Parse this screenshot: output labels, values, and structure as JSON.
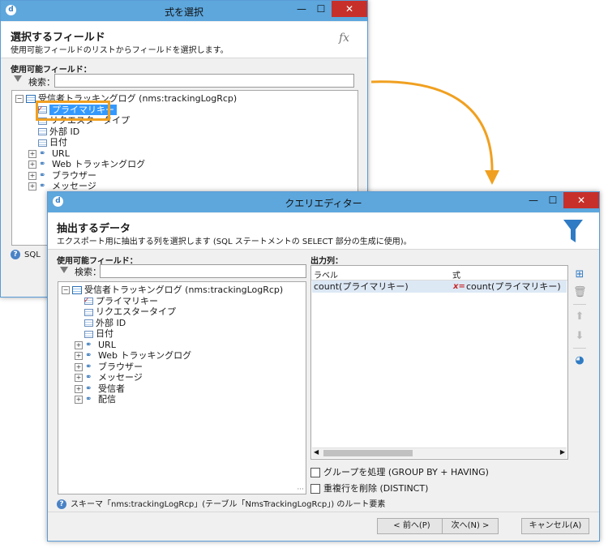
{
  "back_window": {
    "title": "式を選択",
    "heading": "選択するフィールド",
    "subtitle": "使用可能フィールドのリストからフィールドを選択します。",
    "fx_label": "fx",
    "available_fields_label": "使用可能フィールド：",
    "search_label": "検索：",
    "tree": [
      {
        "label": "受信者トラッキングログ (nms:trackingLogRcp)",
        "icon": "table-icon",
        "expander": "−"
      },
      {
        "label": "プライマリキー",
        "icon": "primary-key-icon",
        "selected": true
      },
      {
        "label": "リクエスタータイプ",
        "icon": "field-icon"
      },
      {
        "label": "外部 ID",
        "icon": "field-icon"
      },
      {
        "label": "日付",
        "icon": "field-icon"
      },
      {
        "label": "URL",
        "icon": "link-icon",
        "expander": "+"
      },
      {
        "label": "Web トラッキングログ",
        "icon": "link-icon",
        "expander": "+"
      },
      {
        "label": "ブラウザー",
        "icon": "link-icon",
        "expander": "+"
      },
      {
        "label": "メッセージ",
        "icon": "link-icon",
        "expander": "+"
      }
    ],
    "status_text": "SQL"
  },
  "front_window": {
    "title": "クエリエディター",
    "heading": "抽出するデータ",
    "subtitle": "エクスポート用に抽出する列を選択します (SQL ステートメントの SELECT 部分の生成に使用)。",
    "available_fields_label": "使用可能フィールド：",
    "search_label": "検索：",
    "tree": [
      {
        "label": "受信者トラッキングログ (nms:trackingLogRcp)",
        "icon": "table-icon",
        "expander": "−"
      },
      {
        "label": "プライマリキー",
        "icon": "primary-key-icon"
      },
      {
        "label": "リクエスタータイプ",
        "icon": "field-icon"
      },
      {
        "label": "外部 ID",
        "icon": "field-icon"
      },
      {
        "label": "日付",
        "icon": "field-icon"
      },
      {
        "label": "URL",
        "icon": "link-icon",
        "expander": "+"
      },
      {
        "label": "Web トラッキングログ",
        "icon": "link-icon",
        "expander": "+"
      },
      {
        "label": "ブラウザー",
        "icon": "link-icon",
        "expander": "+"
      },
      {
        "label": "メッセージ",
        "icon": "link-icon",
        "expander": "+"
      },
      {
        "label": "受信者",
        "icon": "link-icon",
        "expander": "+"
      },
      {
        "label": "配信",
        "icon": "link-icon",
        "expander": "+"
      }
    ],
    "output_label": "出力列：",
    "columns": {
      "label": "ラベル",
      "expression": "式"
    },
    "rows": [
      {
        "label": "count(プライマリキー)",
        "expression": "count(プライマリキー)",
        "expr_icon": "x="
      }
    ],
    "group_by_label": "グループを処理 (GROUP BY + HAVING)",
    "distinct_label": "重複行を削除 (DISTINCT)",
    "status_text": "スキーマ「nms:trackingLogRcp」(テーブル「NmsTrackingLogRcp」) のルート要素",
    "buttons": {
      "prev": "< 前へ(P)",
      "next": "次へ(N) >",
      "cancel": "キャンセル(A)"
    },
    "tree_footer": "···"
  },
  "colors": {
    "titlebar": "#5da7dd",
    "close": "#c7302a",
    "highlight": "#f0a020",
    "selection": "#3399ff",
    "filter": "#2f7bc4"
  }
}
